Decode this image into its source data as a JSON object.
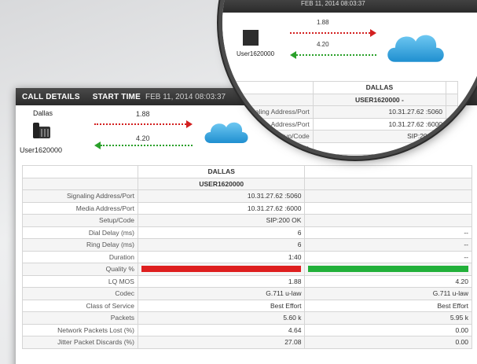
{
  "header": {
    "title": "CALL DETAILS",
    "start_time_label": "START TIME",
    "start_time": "FEB 11, 2014 08:03:37"
  },
  "magnifier_header_text": "FEB 11, 2014 08:03:37",
  "endpoint": {
    "location": "Dallas",
    "user": "User1620000",
    "icon": "desk-phone-icon"
  },
  "flows": {
    "outbound_value": "1.88",
    "inbound_value": "4.20",
    "outbound_color": "#d32020",
    "inbound_color": "#2aa02a"
  },
  "network_icon": "cloud-icon",
  "table": {
    "header_location": "DALLAS",
    "header_user": "USER1620000",
    "magnifier_header_user": "USER1620000 -",
    "rows": [
      {
        "label": "Signaling Address/Port",
        "a": "10.31.27.62 :5060",
        "b": ""
      },
      {
        "label": "Media Address/Port",
        "a": "10.31.27.62 :6000",
        "b": ""
      },
      {
        "label": "Setup/Code",
        "a": "SIP:200 OK",
        "b": ""
      },
      {
        "label": "Dial Delay (ms)",
        "a": "6",
        "b": "--"
      },
      {
        "label": "Ring Delay (ms)",
        "a": "6",
        "b": "--"
      },
      {
        "label": "Duration",
        "a": "1:40",
        "b": "--"
      },
      {
        "label": "Quality %",
        "a": "",
        "b": ""
      },
      {
        "label": "LQ MOS",
        "a": "1.88",
        "b": "4.20"
      },
      {
        "label": "Codec",
        "a": "G.711 u-law",
        "b": "G.711 u-law"
      },
      {
        "label": "Class of Service",
        "a": "Best Effort",
        "b": "Best Effort"
      },
      {
        "label": "Packets",
        "a": "5.60 k",
        "b": "5.95 k"
      },
      {
        "label": "Network Packets Lost (%)",
        "a": "4.64",
        "b": "0.00"
      },
      {
        "label": "Jitter Packet Discards (%)",
        "a": "27.08",
        "b": "0.00"
      }
    ],
    "magnifier_rows": [
      {
        "label": "Signaling Address/Port",
        "a": "10.31.27.62 :5060"
      },
      {
        "label": "Media Address/Port",
        "a": "10.31.27.62 :6000"
      },
      {
        "label": "Setup/Code",
        "a": "SIP:200 OK"
      },
      {
        "label": "Dial Delay (ms)",
        "a": "6"
      },
      {
        "label": "Ring Delay (ms)",
        "a": "6"
      },
      {
        "label": "Duration",
        "a": "1:40"
      },
      {
        "label": "Quality %",
        "a": ""
      },
      {
        "label": "LQ MOS",
        "a": "1.88"
      },
      {
        "label": "Codec",
        "a": "G.711 u-law"
      },
      {
        "label": "Class of Service",
        "a": "Best Effort"
      },
      {
        "label": "Packets",
        "a": "5.6"
      },
      {
        "label": "Packets Lost (%)",
        "a": "--"
      },
      {
        "label": "Discards (%)",
        "a": "--"
      },
      {
        "label": "(ms)",
        "a": "--"
      }
    ],
    "quality_colors": {
      "a": "#de1f1f",
      "b": "#22b03a"
    }
  }
}
